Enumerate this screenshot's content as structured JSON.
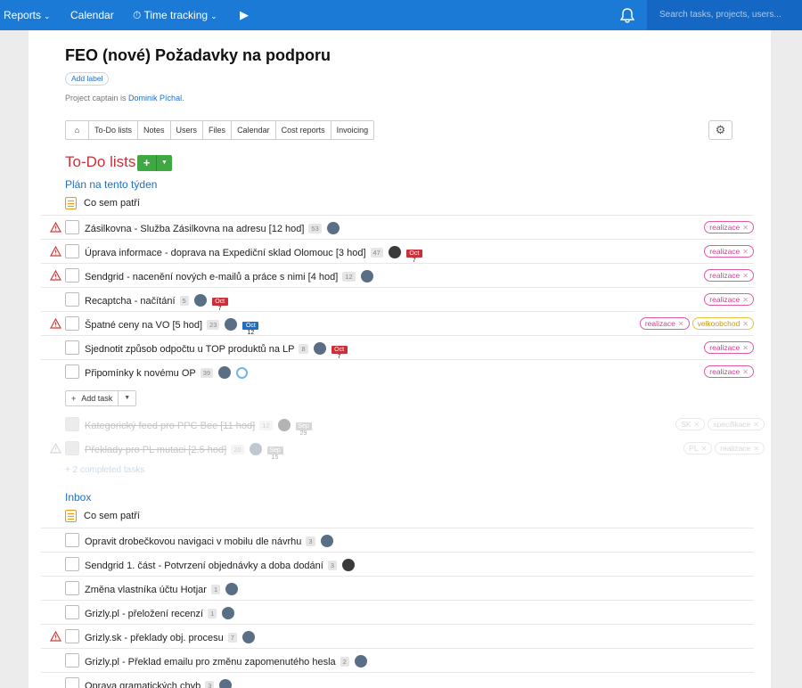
{
  "topbar": {
    "reports": "Reports",
    "calendar": "Calendar",
    "time_tracking": "Time tracking",
    "search_placeholder": "Search tasks, projects, users..."
  },
  "project": {
    "title": "FEO (nové) Požadavky na podporu",
    "add_label": "Add label",
    "captain_prefix": "Project captain is ",
    "captain_name": "Dominik Píchal."
  },
  "tabs": [
    "To-Do lists",
    "Notes",
    "Users",
    "Files",
    "Calendar",
    "Cost reports",
    "Invoicing"
  ],
  "todo_heading": "To-Do lists",
  "lists": [
    {
      "name": "Plán na tento týden",
      "note": "Co sem patří",
      "tasks": [
        {
          "name": "Zásilkovna - Služba Zásilkovna na adresu [12 hod]",
          "count": "53",
          "tags": [
            "realizace"
          ]
        },
        {
          "name": "Úprava informace - doprava na Expediční sklad Olomouc [3 hod]",
          "count": "47",
          "due_month": "Oct",
          "due_day": "7",
          "tags": [
            "realizace"
          ]
        },
        {
          "name": "Sendgrid - nacenění nových e-mailů a práce s nimi [4 hod]",
          "count": "12",
          "tags": [
            "realizace"
          ]
        },
        {
          "name": "Recaptcha - načítání",
          "count": "5",
          "due_month": "Oct",
          "due_day": "7",
          "tags": [
            "realizace"
          ]
        },
        {
          "name": "Špatné ceny na VO [5 hod]",
          "count": "23",
          "due_month": "Oct",
          "due_day": "12",
          "tags": [
            "realizace",
            "velkoobchod"
          ]
        },
        {
          "name": "Sjednotit způsob odpočtu u TOP produktů na LP",
          "count": "8",
          "due_month": "Oct",
          "due_day": "7",
          "tags": [
            "realizace"
          ]
        },
        {
          "name": "Připomínky k novému OP",
          "count": "39",
          "tags": [
            "realizace"
          ]
        }
      ],
      "add_task": "Add task",
      "completed": [
        {
          "name": "Kategorický feed pro PPC Bee [11 hod]",
          "count": "12",
          "due_month": "Sep",
          "due_day": "29",
          "tags": [
            "SK",
            "specifikace"
          ]
        },
        {
          "name": "Překlady pro PL mutaci [2.5 hod]",
          "count": "20",
          "due_month": "Sep",
          "due_day": "15",
          "tags": [
            "PL",
            "realizace"
          ]
        }
      ],
      "completed_link": "+ 2 completed tasks"
    },
    {
      "name": "Inbox",
      "note": "Co sem patří",
      "tasks": [
        {
          "name": "Opravit drobečkovou navigaci v mobilu dle návrhu",
          "count": "3"
        },
        {
          "name": "Sendgrid 1. část - Potvrzení objednávky a doba dodání",
          "count": "3"
        },
        {
          "name": "Změna vlastníka účtu Hotjar",
          "count": "1"
        },
        {
          "name": "Grizly.pl - přeložení recenzí",
          "count": "1"
        },
        {
          "name": "Grizly.sk - překlady obj. procesu",
          "count": "7"
        },
        {
          "name": "Grizly.pl - Překlad emailu pro změnu zapomenutého hesla",
          "count": "2"
        },
        {
          "name": "Oprava gramatických chyb",
          "count": "3"
        }
      ]
    }
  ],
  "colors": {
    "topbar": "#1b7ad6",
    "accent_red": "#c8303a",
    "link_blue": "#1f6fc6",
    "tag_pink": "#d03f92",
    "add_green": "#3ea842"
  }
}
